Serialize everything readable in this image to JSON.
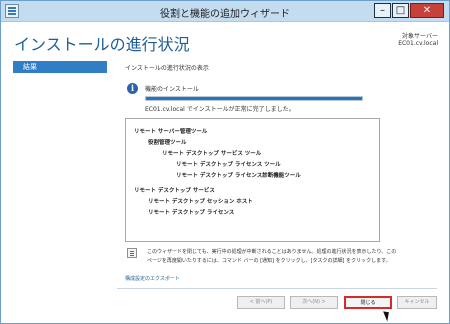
{
  "window": {
    "title": "役割と機能の追加ウィザード",
    "controls": {
      "minimize": "–",
      "maximize": "□",
      "close": "✕"
    }
  },
  "header": {
    "page_title": "インストールの進行状況",
    "dest_label": "対象サーバー",
    "dest_server": "EC01.cv.local"
  },
  "sidebar": {
    "items": [
      {
        "label": "結果",
        "selected": true
      }
    ]
  },
  "content": {
    "section_label": "インストールの進行状況の表示",
    "status_title": "機能のインストール",
    "progress": 1.0,
    "status_msg": "EC01.cv.local でインストールが正常に完了しました。",
    "results": [
      "リモート サーバー管理ツール",
      "役割管理ツール",
      "リモート デスクトップ サービス ツール",
      "リモート デスクトップ ライセンス ツール",
      "リモート デスクトップ ライセンス診断機能ツール",
      "リモート デスクトップ サービス",
      "リモート デスクトップ セッション ホスト",
      "リモート デスクトップ ライセンス"
    ],
    "note_lines": [
      "このウィザードを閉じても、実行中の処理が中断されることはありません。処理の進行状況を表示したり、この",
      "ページを再度開いたりするには、コマンド バーの [通知] をクリックし、[タスクの詳細] をクリックします。"
    ],
    "export_link": "構成設定のエクスポート"
  },
  "footer": {
    "prev": "< 前へ(P)",
    "next": "次へ(N) >",
    "close": "閉じる",
    "cancel": "キャンセル"
  },
  "colors": {
    "accent": "#2f7ec6",
    "title_blue": "#1f5e95",
    "highlight_red": "#d52b2b"
  }
}
